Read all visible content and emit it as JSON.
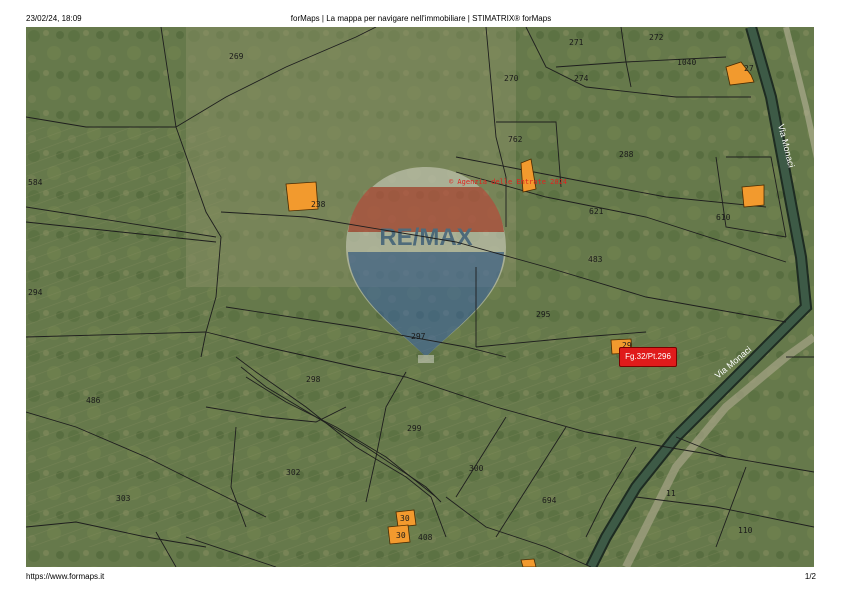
{
  "header": {
    "datetime": "23/02/24, 18:09",
    "title": "forMaps | La mappa per navigare nell'immobiliare | STIMATRIX® forMaps"
  },
  "footer": {
    "url": "https://www.formaps.it",
    "page": "1/2"
  },
  "map": {
    "selected_parcel_badge": "Fg.32/Pt.296",
    "agency_notice": "© Agenzia delle Entrate 2024",
    "watermark_logo": "RE/MAX",
    "roads": [
      "Via Monaci",
      "Via Monaci"
    ],
    "parcels": [
      "269",
      "271",
      "272",
      "270",
      "274",
      "1040",
      "27",
      "762",
      "288",
      "584",
      "238",
      "621",
      "483",
      "610",
      "294",
      "295",
      "297",
      "29",
      "298",
      "486",
      "299",
      "300",
      "302",
      "303",
      "694",
      "11",
      "110",
      "30",
      "30",
      "408"
    ],
    "colors": {
      "building": "#f29a2e",
      "badge": "#e01b1b",
      "parcel_line": "#1e1e1e",
      "road": "#2d3e34"
    }
  }
}
